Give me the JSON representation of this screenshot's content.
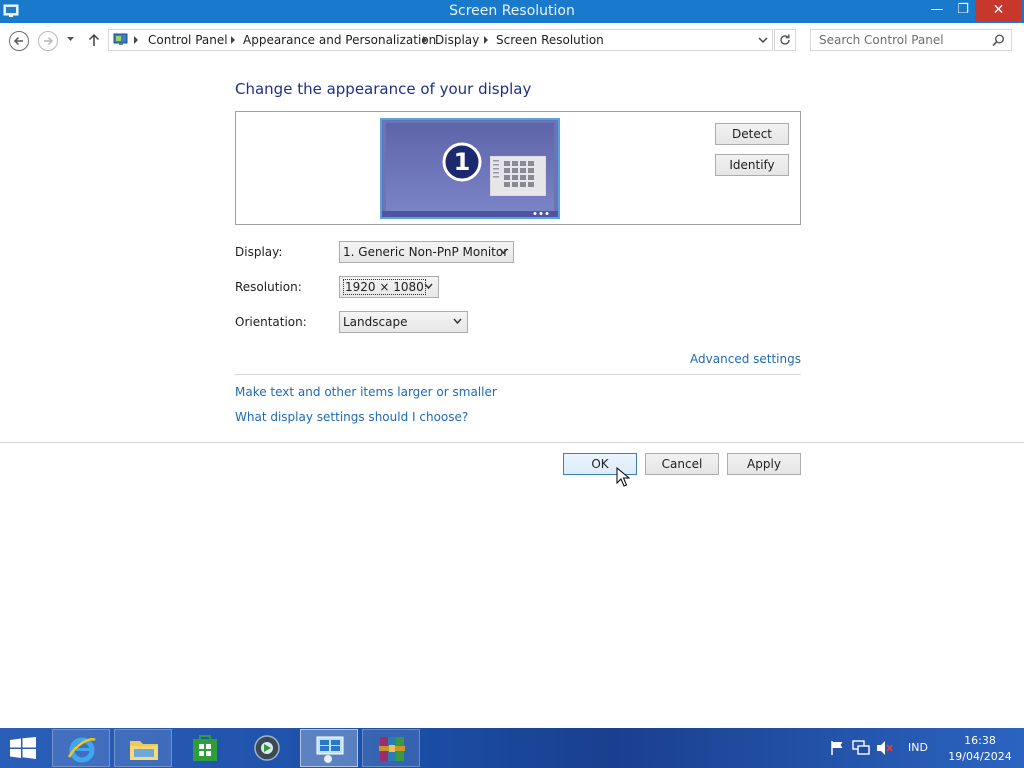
{
  "window": {
    "title": "Screen Resolution",
    "controls": {
      "minimize": "—",
      "maximize": "❐",
      "close": "✕"
    }
  },
  "nav": {
    "breadcrumbs": [
      "Control Panel",
      "Appearance and Personalization",
      "Display",
      "Screen Resolution"
    ],
    "search_placeholder": "Search Control Panel"
  },
  "main": {
    "heading": "Change the appearance of your display",
    "monitor_number": "1",
    "detect_label": "Detect",
    "identify_label": "Identify",
    "display_label": "Display:",
    "display_value": "1. Generic Non-PnP Monitor",
    "resolution_label": "Resolution:",
    "resolution_value": "1920 × 1080",
    "orientation_label": "Orientation:",
    "orientation_value": "Landscape",
    "advanced_link": "Advanced settings",
    "text_size_link": "Make text and other items larger or smaller",
    "help_link": "What display settings should I choose?"
  },
  "footer": {
    "ok_label": "OK",
    "cancel_label": "Cancel",
    "apply_label": "Apply"
  },
  "taskbar": {
    "items": [
      "internet-explorer-icon",
      "file-explorer-icon",
      "store-icon",
      "media-center-icon",
      "control-panel-icon",
      "winrar-icon"
    ],
    "language": "IND",
    "time": "16:38",
    "date": "19/04/2024"
  },
  "colors": {
    "titlebar": "#1979ca",
    "heading": "#1e3287",
    "link": "#1e6ab4",
    "close_button": "#c7372c"
  }
}
